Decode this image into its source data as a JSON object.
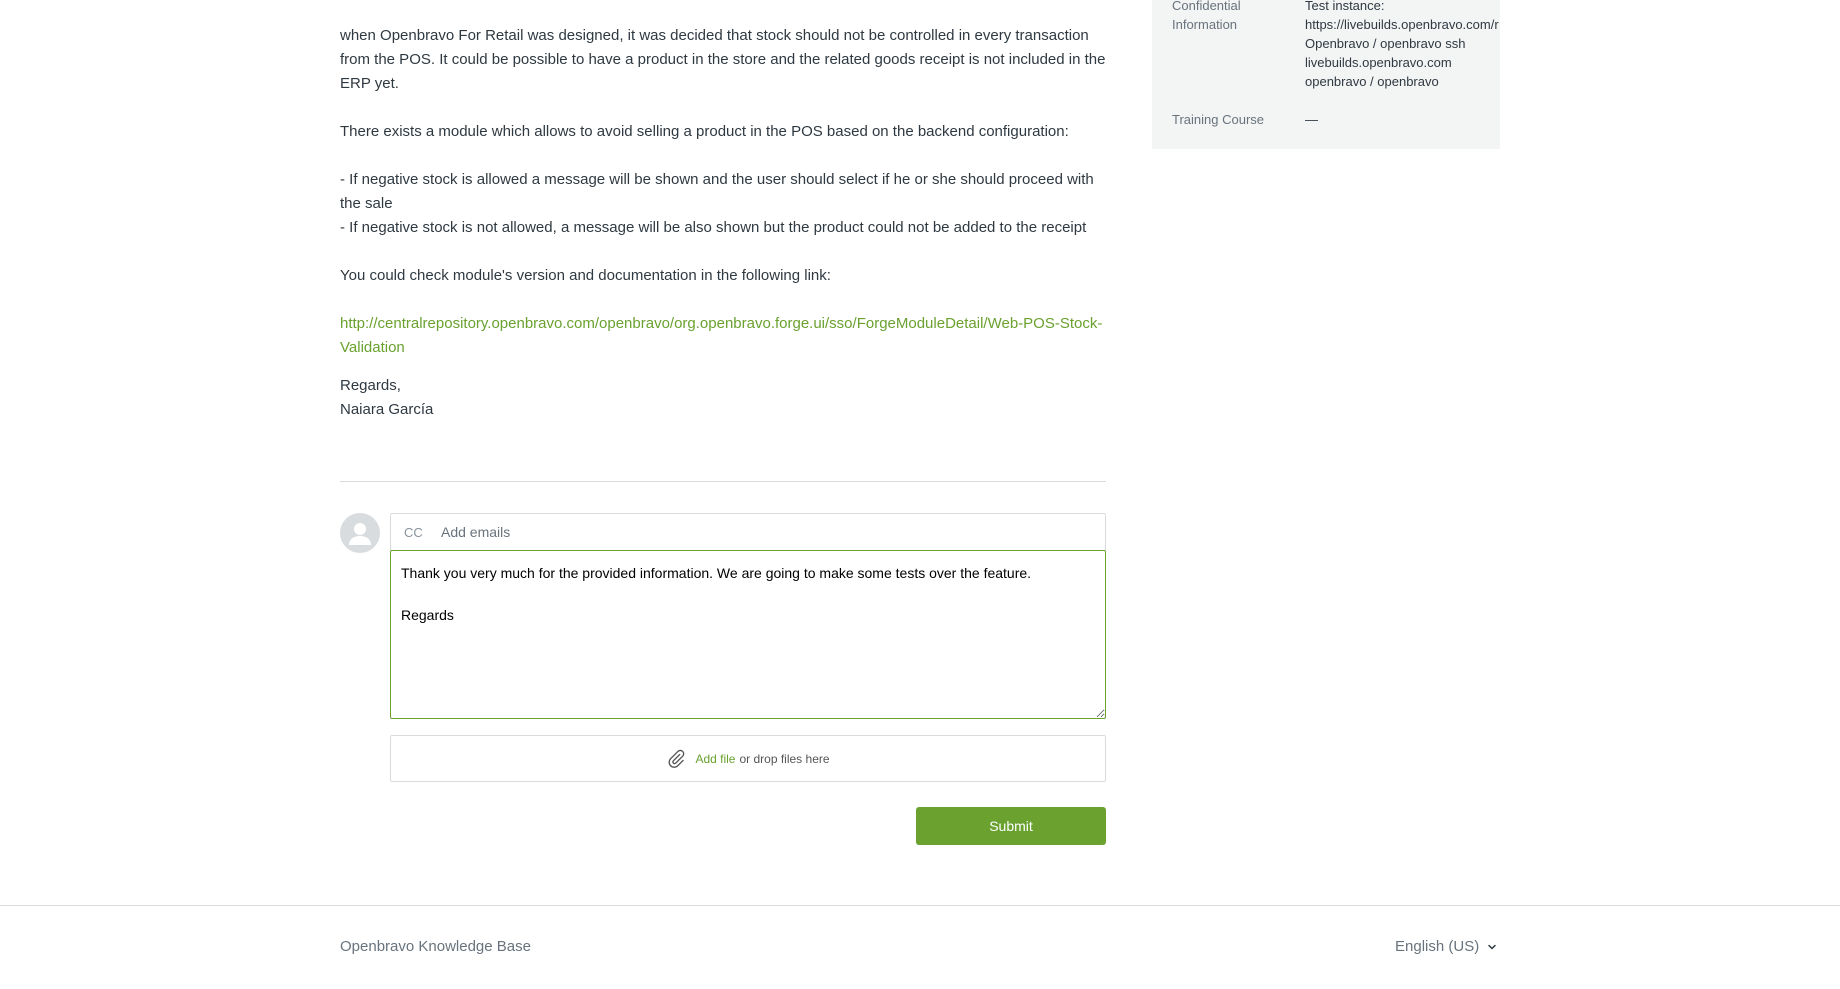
{
  "message": {
    "para1": "when Openbravo For Retail was designed, it was decided that stock should not be controlled in every transaction from the POS. It could be possible to have a product in the store and the related goods receipt is not included in the ERP yet.",
    "para2": "There exists a module which allows to avoid selling a product in the POS based on the backend configuration:",
    "bullet1": "- If negative stock is allowed a message will be shown and the user should select if he or she should proceed with the sale",
    "bullet2": "- If negative stock is not allowed, a message will be also shown but the product could not be added to the receipt",
    "para3": "You could check module's version and documentation in the following link:",
    "link": "http://centralrepository.openbravo.com/openbravo/org.openbravo.forge.ui/sso/ForgeModuleDetail/Web-POS-Stock-Validation",
    "sign_off": "Regards,",
    "signature": "Naiara García"
  },
  "reply_form": {
    "cc_label": "CC",
    "cc_placeholder": "Add emails",
    "body": "Thank you very much for the provided information. We are going to make some tests over the feature.\n\nRegards",
    "add_file_label": "Add file",
    "drop_hint": "or drop files here",
    "submit_label": "Submit"
  },
  "sidebar": {
    "confidential_label_line1": "Confidential",
    "confidential_label_line2": "Information",
    "confidential_values": [
      "Test instance:",
      "https://livebuilds.openbravo.com/r",
      "Openbravo / openbravo ssh",
      "livebuilds.openbravo.com",
      "openbravo / openbravo"
    ],
    "training_label": "Training Course",
    "training_value": "—"
  },
  "footer": {
    "site_name": "Openbravo Knowledge Base",
    "language": "English (US)"
  },
  "colors": {
    "accent": "#6aa12f",
    "sidebar_bg": "#f3f4f4",
    "border": "#d8dcde"
  }
}
